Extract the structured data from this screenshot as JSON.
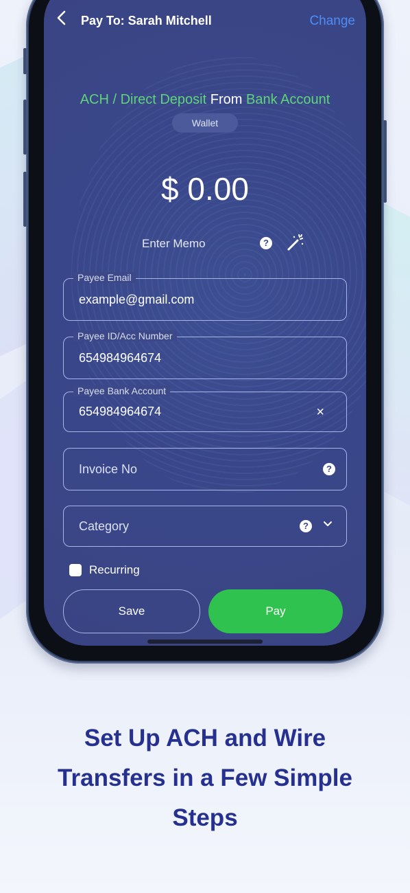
{
  "header": {
    "title": "Pay To: Sarah Mitchell",
    "change_label": "Change",
    "back_icon": "chevron-left-icon"
  },
  "source": {
    "part1": "ACH / Direct Deposit",
    "part2": "From",
    "part3": "Bank Account",
    "wallet_label": "Wallet"
  },
  "amount": "$ 0.00",
  "memo": {
    "placeholder": "Enter Memo",
    "help_icon": "help-icon",
    "wand_icon": "magic-wand-icon"
  },
  "form": {
    "payee_email": {
      "label": "Payee Email",
      "value": "example@gmail.com"
    },
    "payee_id": {
      "label": "Payee ID/Acc Number",
      "value": "654984964674"
    },
    "payee_bank": {
      "label": "Payee Bank Account",
      "value": "654984964674",
      "clear": "×"
    },
    "invoice": {
      "placeholder": "Invoice No"
    },
    "category": {
      "placeholder": "Category"
    }
  },
  "recurring": {
    "label": "Recurring",
    "checked": false
  },
  "buttons": {
    "save": "Save",
    "pay": "Pay"
  },
  "colors": {
    "accent_green": "#5fd47a",
    "pay_button": "#2fc24f",
    "change_link": "#4f8df5",
    "screen_bg": "#3a4585",
    "promo_text": "#26318f"
  },
  "promo": {
    "line1": "Set Up ACH and Wire",
    "line2": "Transfers in a Few Simple",
    "line3": "Steps"
  }
}
